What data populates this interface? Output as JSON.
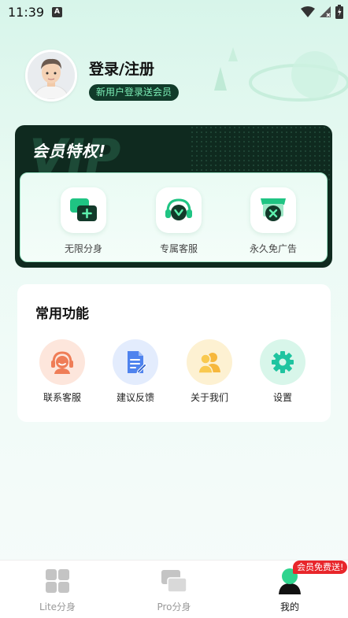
{
  "status_bar": {
    "time": "11:39",
    "notification_icon": "A"
  },
  "profile": {
    "title": "登录/注册",
    "badge": "新用户登录送会员"
  },
  "vip": {
    "title": "会员特权!",
    "watermark": "VIP",
    "items": [
      {
        "label": "无限分身",
        "icon": "plus-icon"
      },
      {
        "label": "专属客服",
        "icon": "headset-icon"
      },
      {
        "label": "永久免广告",
        "icon": "no-ads-icon"
      }
    ]
  },
  "functions": {
    "title": "常用功能",
    "items": [
      {
        "label": "联系客服",
        "icon": "customer-service-icon"
      },
      {
        "label": "建议反馈",
        "icon": "feedback-icon"
      },
      {
        "label": "关于我们",
        "icon": "about-us-icon"
      },
      {
        "label": "设置",
        "icon": "settings-icon"
      }
    ]
  },
  "tabs": [
    {
      "label": "Lite分身",
      "active": false
    },
    {
      "label": "Pro分身",
      "active": false
    },
    {
      "label": "我的",
      "active": true
    }
  ],
  "promo_badge": "会员免费送!",
  "colors": {
    "accent_green": "#1fc483",
    "dark_green": "#0f2a1f",
    "badge_text": "#7ef0b8",
    "promo_red": "#e8262b"
  }
}
